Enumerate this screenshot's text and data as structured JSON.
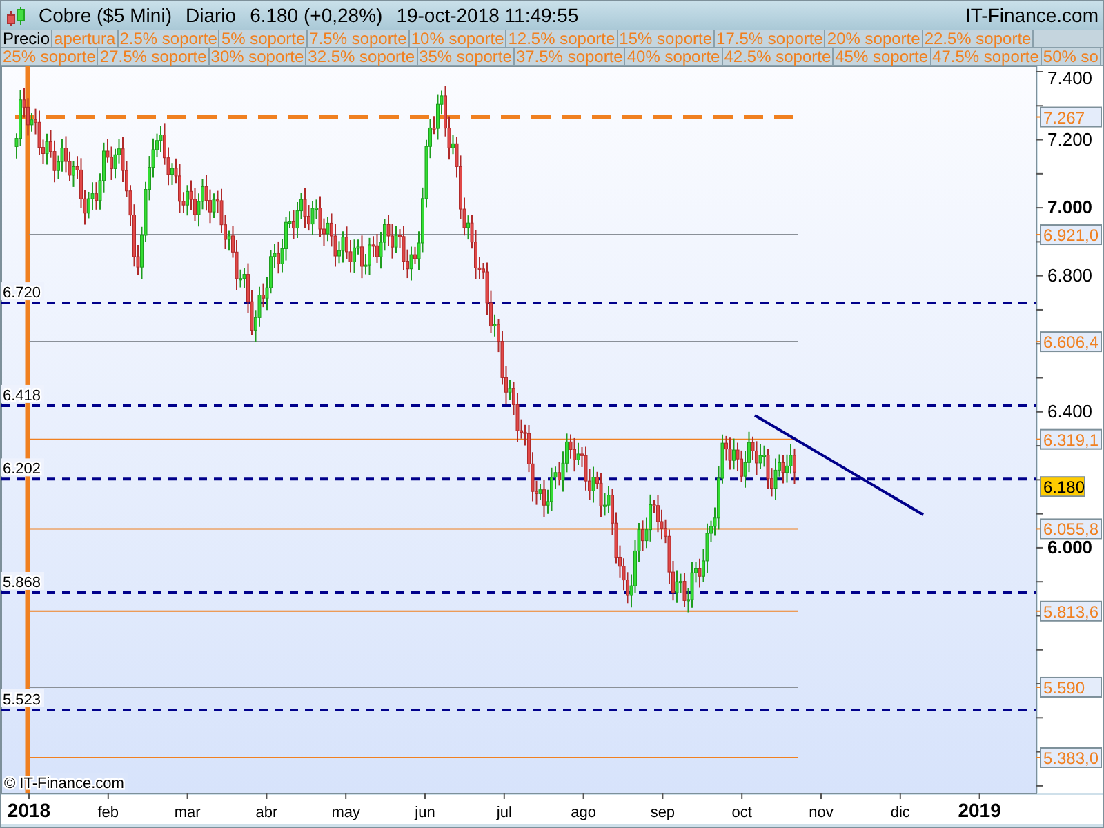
{
  "title_bar": {
    "instrument": "Cobre ($5 Mini)",
    "period": "Diario",
    "quote": "6.180 (+0,28%)",
    "timestamp": "19-oct-2018 11:49:55",
    "site": "IT-Finance.com"
  },
  "legend_rows": [
    [
      {
        "label": "Precio",
        "color": "#000000"
      },
      {
        "label": "apertura",
        "color": "#f08020"
      },
      {
        "label": "2.5% soporte",
        "color": "#f08020"
      },
      {
        "label": "5% soporte",
        "color": "#f08020"
      },
      {
        "label": "7.5% soporte",
        "color": "#f08020"
      },
      {
        "label": "10% soporte",
        "color": "#f08020"
      },
      {
        "label": "12.5% soporte",
        "color": "#f08020"
      },
      {
        "label": "15% soporte",
        "color": "#f08020"
      },
      {
        "label": "17.5% soporte",
        "color": "#f08020"
      },
      {
        "label": "20% soporte",
        "color": "#f08020"
      },
      {
        "label": "22.5% soporte",
        "color": "#f08020"
      }
    ],
    [
      {
        "label": "25% soporte",
        "color": "#f08020"
      },
      {
        "label": "27.5% soporte",
        "color": "#f08020"
      },
      {
        "label": "30% soporte",
        "color": "#f08020"
      },
      {
        "label": "32.5% soporte",
        "color": "#f08020"
      },
      {
        "label": "35% soporte",
        "color": "#f08020"
      },
      {
        "label": "37.5% soporte",
        "color": "#f08020"
      },
      {
        "label": "40% soporte",
        "color": "#f08020"
      },
      {
        "label": "42.5% soporte",
        "color": "#f08020"
      },
      {
        "label": "45% soporte",
        "color": "#f08020"
      },
      {
        "label": "47.5% soporte",
        "color": "#f08020"
      },
      {
        "label": "50% so",
        "color": "#f08020"
      }
    ]
  ],
  "chart": {
    "price_axis": [
      {
        "label": "7.400",
        "bold": false
      },
      {
        "label": "7.200",
        "bold": false
      },
      {
        "label": "7.000",
        "bold": true
      },
      {
        "label": "6.800",
        "bold": false
      },
      {
        "label": "6.400",
        "bold": false
      },
      {
        "label": "6.000",
        "bold": true
      }
    ],
    "time_axis": [
      {
        "label": "2018",
        "bold": true
      },
      {
        "label": "feb",
        "bold": false
      },
      {
        "label": "mar",
        "bold": false
      },
      {
        "label": "abr",
        "bold": false
      },
      {
        "label": "may",
        "bold": false
      },
      {
        "label": "jun",
        "bold": false
      },
      {
        "label": "jul",
        "bold": false
      },
      {
        "label": "ago",
        "bold": false
      },
      {
        "label": "sep",
        "bold": false
      },
      {
        "label": "oct",
        "bold": false
      },
      {
        "label": "nov",
        "bold": false
      },
      {
        "label": "dic",
        "bold": false
      },
      {
        "label": "2019",
        "bold": true
      }
    ],
    "levels": [
      {
        "kind": "target",
        "label": "7.267"
      },
      {
        "kind": "grid",
        "label": "6.921,0"
      },
      {
        "kind": "support",
        "label": "6.720"
      },
      {
        "kind": "grid",
        "label": "6.606,4"
      },
      {
        "kind": "support",
        "label": "6.418"
      },
      {
        "kind": "band",
        "label": "6.319,1"
      },
      {
        "kind": "support",
        "label": "6.202"
      },
      {
        "kind": "band",
        "label": "6.055,8"
      },
      {
        "kind": "support",
        "label": "5.868"
      },
      {
        "kind": "band",
        "label": "5.813,6"
      },
      {
        "kind": "grid",
        "label": "5.590"
      },
      {
        "kind": "support",
        "label": "5.523"
      },
      {
        "kind": "band",
        "label": "5.383,0"
      }
    ],
    "current_price": "6.180",
    "copyright": "© IT-Finance.com"
  }
}
